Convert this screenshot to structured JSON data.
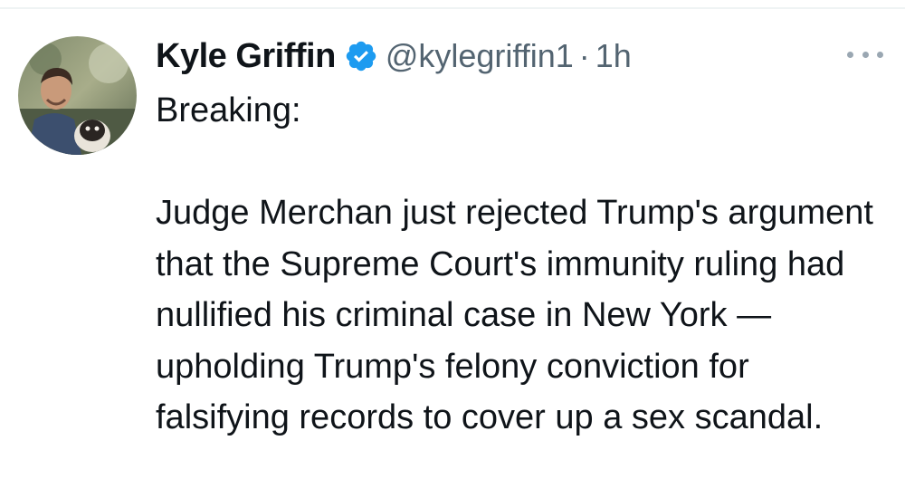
{
  "tweet": {
    "author": {
      "name": "Kyle Griffin",
      "verified_icon": "verified-badge-icon",
      "handle": "@kylegriffin1",
      "separator": "·",
      "timestamp": "1h"
    },
    "more_icon": "more-horizontal-icon",
    "text": {
      "line1": "Breaking:",
      "paragraph": "Judge Merchan just rejected Trump's argument that the Supreme Court's immunity ruling had nullified his criminal case in New York — upholding Trump's felony conviction for falsifying records to cover up a sex scandal."
    }
  },
  "colors": {
    "verified_blue": "#1d9bf0",
    "secondary_text": "#536471",
    "primary_text": "#0f1419"
  }
}
